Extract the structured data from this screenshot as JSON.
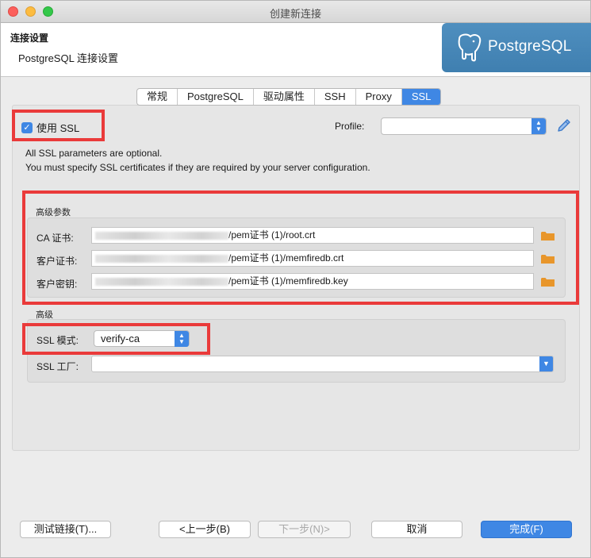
{
  "window": {
    "title": "创建新连接"
  },
  "header": {
    "title": "连接设置",
    "subtitle": "PostgreSQL 连接设置",
    "logo_text": "PostgreSQL"
  },
  "tabs": [
    {
      "label": "常规",
      "active": false
    },
    {
      "label": "PostgreSQL",
      "active": false
    },
    {
      "label": "驱动属性",
      "active": false
    },
    {
      "label": "SSH",
      "active": false
    },
    {
      "label": "Proxy",
      "active": false
    },
    {
      "label": "SSL",
      "active": true
    }
  ],
  "ssl": {
    "use_ssl_label": "使用 SSL",
    "use_ssl_checked": true,
    "profile_label": "Profile:",
    "profile_value": "",
    "info_line1": "All SSL parameters are optional.",
    "info_line2": "You must specify SSL certificates if they are required by your server configuration."
  },
  "advanced_params": {
    "group_label": "高级参数",
    "ca_cert": {
      "label": "CA 证书:",
      "value_suffix": "/pem证书 (1)/root.crt"
    },
    "client_cert": {
      "label": "客户证书:",
      "value_suffix": "/pem证书 (1)/memfiredb.crt"
    },
    "client_key": {
      "label": "客户密钥:",
      "value_suffix": "/pem证书 (1)/memfiredb.key"
    }
  },
  "advanced": {
    "group_label": "高级",
    "ssl_mode_label": "SSL 模式:",
    "ssl_mode_value": "verify-ca",
    "ssl_factory_label": "SSL 工厂:",
    "ssl_factory_value": ""
  },
  "buttons": {
    "test": "测试链接(T)...",
    "back": "<上一步(B)",
    "next": "下一步(N)>",
    "cancel": "取消",
    "finish": "完成(F)"
  },
  "icons": {
    "pencil": "pencil-edit-icon",
    "folder": "folder-icon",
    "select_arrows": "updown-chevron-icon"
  },
  "colors": {
    "accent": "#3f87e4",
    "highlight": "#ea3a3a",
    "folder": "#e8962b",
    "logo_bg": "#4586b8"
  }
}
